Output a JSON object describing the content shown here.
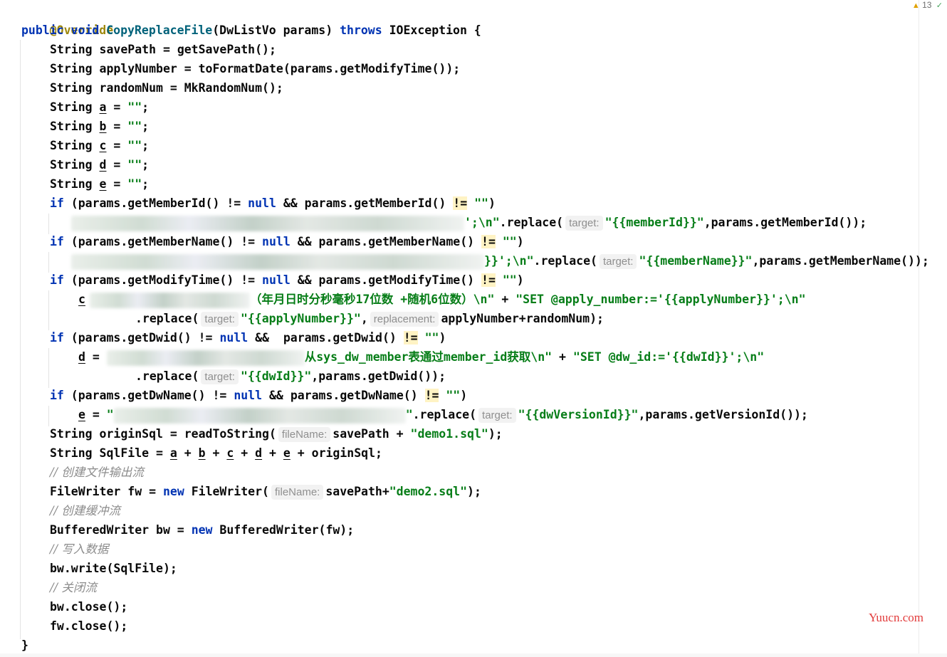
{
  "editor": {
    "warning_count": "13",
    "watermark": "Yuucn.com",
    "code": {
      "annotation": "@Override",
      "kw_public": "public",
      "kw_void": "void",
      "method_name": "CopyReplaceFile",
      "signature_params": "(DwListVo params) ",
      "kw_throws": "throws",
      "exception": " IOException {",
      "l3_a": "String savePath = ",
      "l3_fn": "getSavePath",
      "l3_b": "();",
      "l4_a": "String applyNumber = ",
      "l4_fn": "toFormatDate",
      "l4_b": "(params.getModifyTime());",
      "l5_a": "String randomNum = ",
      "l5_fn": "MkRandomNum",
      "l5_b": "();",
      "string_kw": "String ",
      "var_a": "a",
      "var_b": "b",
      "var_c": "c",
      "var_d": "d",
      "var_e": "e",
      "assign_empty": " = ",
      "empty_str": "\"\"",
      "semi": ";",
      "kw_if": "if",
      "kw_null": "null",
      "kw_new": "new",
      "not_eq": "!=",
      "amp": " && ",
      "if1_a": " (params.getMemberId() ",
      "if1_b": "params.getMemberId() ",
      "close_paren": ")",
      "l12_str": "';\\n\"",
      "l12_rep": ".replace(",
      "hint_target": "target:",
      "hint_replacement": "replacement:",
      "hint_filename": "fileName:",
      "str_member_id": "\"{{memberId}}\"",
      "l12_end": ",params.getMemberId());",
      "if2_a": " (params.getMemberName() ",
      "if2_b": "params.getMemberName() ",
      "l14_str": "}}';\\n\"",
      "str_member_name": "\"{{memberName}}\"",
      "l14_end": ",params.getMemberName());",
      "if3_a": " (params.getModifyTime() ",
      "if3_b": "params.getModifyTime() ",
      "l16_str": "（年月日时分秒毫秒17位数 +随机6位数）\\n\"",
      "plus": " + ",
      "l16_str2": "\"SET @apply_number:='{{applyNumber}}';\\n\"",
      "l17_rep": ".replace(",
      "str_apply_number": "\"{{applyNumber}}\"",
      "l17_end": "applyNumber+randomNum);",
      "if4_a": " (params.getDwid() ",
      "if4_b": " params.getDwid() ",
      "l19_str": "从sys_dw_member表通过member_id获取\\n\"",
      "l19_str2": "\"SET @dw_id:='{{dwId}}';\\n\"",
      "str_dwid": "\"{{dwId}}\"",
      "l20_end": ",params.getDwid());",
      "if5_a": " (params.getDwName() ",
      "if5_b": "params.getDwName() ",
      "l22_eq": " = ",
      "l22_q": "\"",
      "l22_q2": "\"",
      "str_dw_version": "\"{{dwVersionId}}\"",
      "l22_end": ",params.getVersionId());",
      "l23_a": "String originSql = ",
      "l23_fn": "readToString",
      "l23_mid": "savePath + ",
      "str_demo1": "\"demo1.sql\"",
      "l23_end": ");",
      "l24": "String SqlFile = ",
      "l24_plus": " + ",
      "l24_end": " + originSql;",
      "comment1": "// 创建文件输出流",
      "l26_a": "FileWriter fw = ",
      "l26_b": " FileWriter(",
      "l26_mid": "savePath+",
      "str_demo2": "\"demo2.sql\"",
      "l26_end": ");",
      "comment2": "// 创建缓冲流",
      "l28_a": "BufferedWriter bw = ",
      "l28_b": " BufferedWriter(fw);",
      "comment3": "// 写入数据",
      "l30": "bw.write(SqlFile);",
      "comment4": "// 关闭流",
      "l32": "bw.close();",
      "l33": "fw.close();",
      "closing_brace": "}"
    }
  }
}
